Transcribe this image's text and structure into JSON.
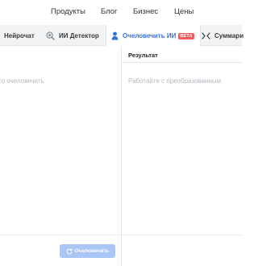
{
  "nav": {
    "products": "Продукты",
    "blog": "Блог",
    "business": "Бизнес",
    "prices": "Цены"
  },
  "tabs": [
    {
      "label": "Нейрочат",
      "icon": "none"
    },
    {
      "label": "ИИ Детектор",
      "icon": "magnifier-ai-icon"
    },
    {
      "label": "Очеловечить ИИ",
      "icon": "person-icon",
      "badge": "BETA",
      "active": true
    },
    {
      "label": "Суммари",
      "icon": "compress-arrows-icon"
    }
  ],
  "input": {
    "placeholder": "то очеловечить"
  },
  "result": {
    "title": "Результат",
    "placeholder": "Работайте с преобразованным"
  },
  "actions": {
    "humanize_label": "Очеловечить"
  },
  "colors": {
    "accent": "#2f6fe8",
    "badge": "#f3595d",
    "button_disabled": "#aac6f5",
    "tabbar_bg": "#f2f3f5"
  }
}
